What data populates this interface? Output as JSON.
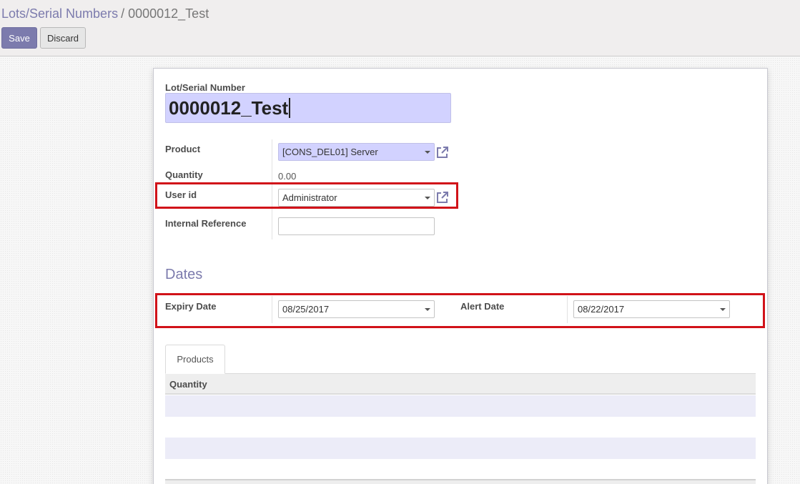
{
  "breadcrumb": {
    "parent": "Lots/Serial Numbers",
    "separator": "/",
    "current": "0000012_Test"
  },
  "buttons": {
    "save": "Save",
    "discard": "Discard"
  },
  "form": {
    "name_label": "Lot/Serial Number",
    "name_value": "0000012_Test",
    "product_label": "Product",
    "product_value": "[CONS_DEL01] Server",
    "quantity_label": "Quantity",
    "quantity_value": "0.00",
    "user_label": "User id",
    "user_value": "Administrator",
    "ref_label": "Internal Reference",
    "ref_value": "",
    "dates_title": "Dates",
    "expiry_label": "Expiry Date",
    "expiry_value": "08/25/2017",
    "alert_label": "Alert Date",
    "alert_value": "08/22/2017"
  },
  "tabs": {
    "products": "Products"
  },
  "table": {
    "columns": [
      "Quantity"
    ]
  },
  "colors": {
    "accent": "#7c7bad",
    "highlight_box": "#d11219",
    "required_field": "#d2d2ff"
  },
  "icons": {
    "external_link": "external-link-icon",
    "dropdown": "chevron-down-icon"
  }
}
